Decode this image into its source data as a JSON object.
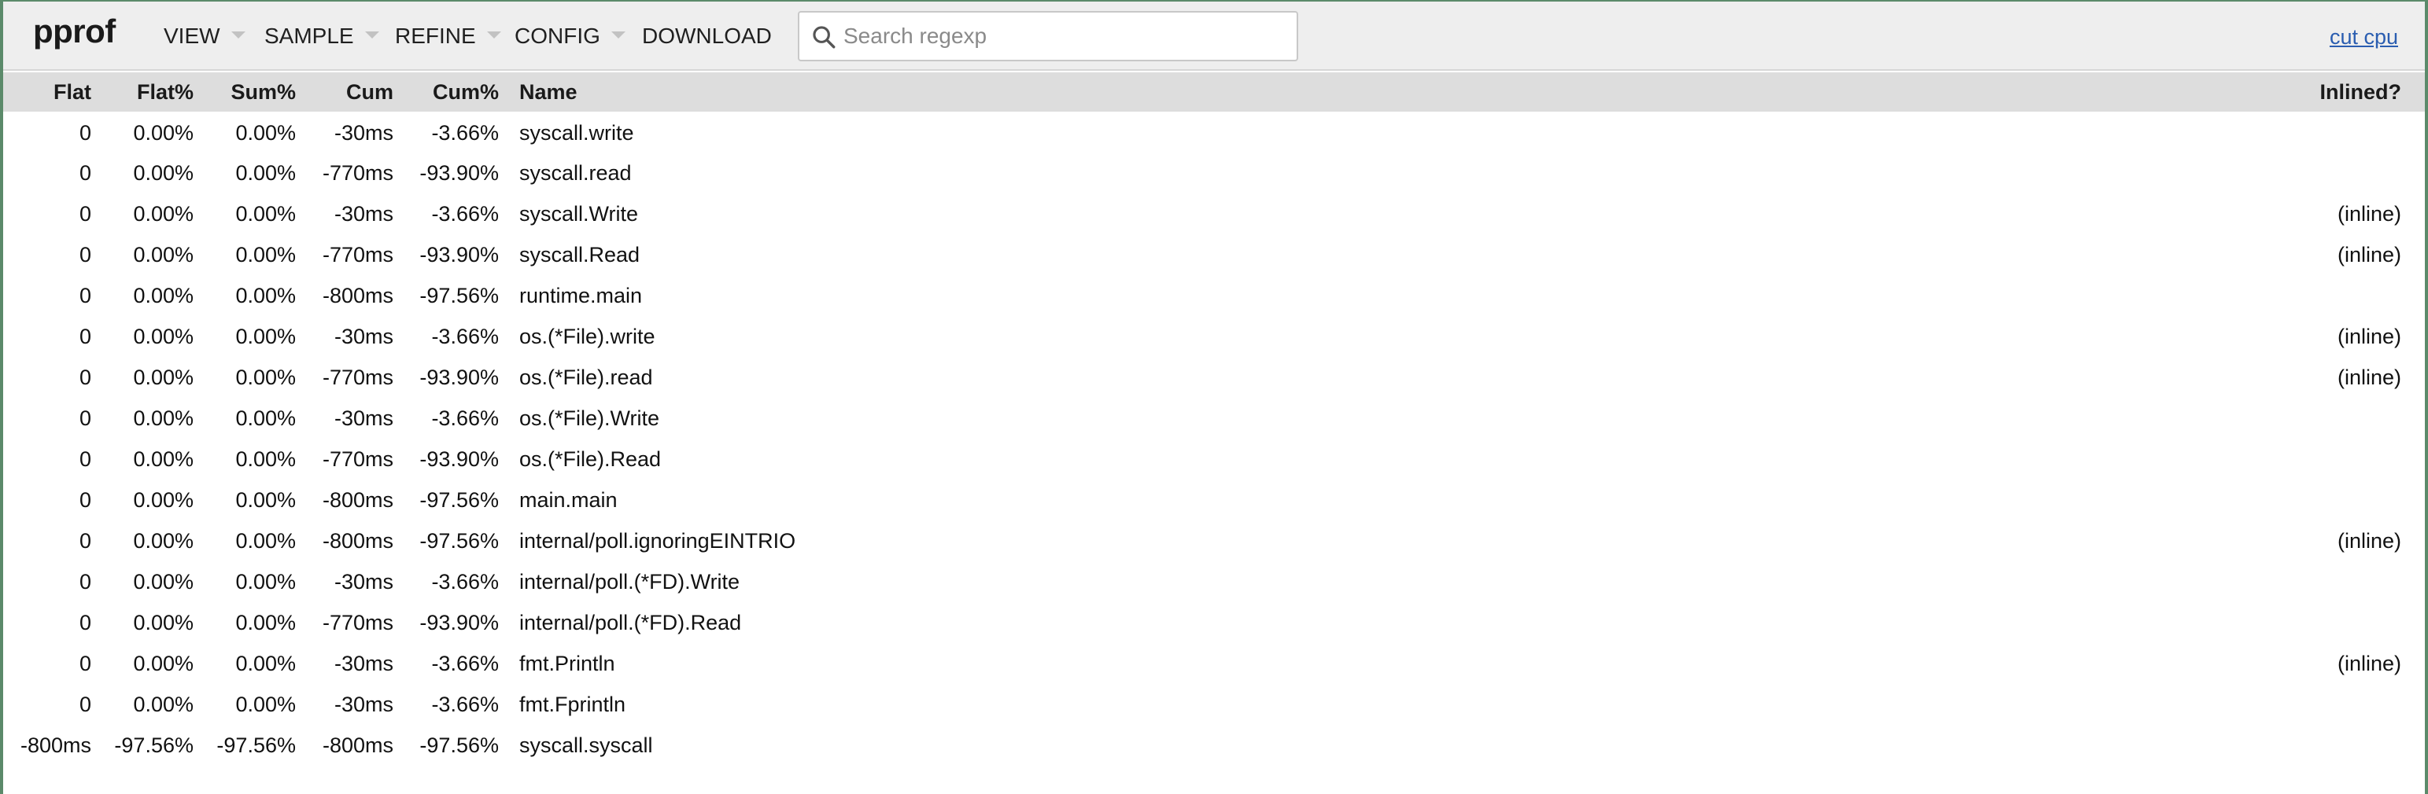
{
  "header": {
    "logo": "pprof",
    "menus": {
      "view": "VIEW",
      "sample": "SAMPLE",
      "refine": "REFINE",
      "config": "CONFIG",
      "download": "DOWNLOAD"
    },
    "search": {
      "placeholder": "Search regexp",
      "value": ""
    },
    "profile_link": "cut cpu"
  },
  "table": {
    "columns": {
      "flat": "Flat",
      "flat_pct": "Flat%",
      "sum_pct": "Sum%",
      "cum": "Cum",
      "cum_pct": "Cum%",
      "name": "Name",
      "inlined": "Inlined?"
    },
    "rows": [
      {
        "flat": "0",
        "flat_pct": "0.00%",
        "sum_pct": "0.00%",
        "cum": "-30ms",
        "cum_pct": "-3.66%",
        "name": "syscall.write",
        "inlined": ""
      },
      {
        "flat": "0",
        "flat_pct": "0.00%",
        "sum_pct": "0.00%",
        "cum": "-770ms",
        "cum_pct": "-93.90%",
        "name": "syscall.read",
        "inlined": ""
      },
      {
        "flat": "0",
        "flat_pct": "0.00%",
        "sum_pct": "0.00%",
        "cum": "-30ms",
        "cum_pct": "-3.66%",
        "name": "syscall.Write",
        "inlined": "(inline)"
      },
      {
        "flat": "0",
        "flat_pct": "0.00%",
        "sum_pct": "0.00%",
        "cum": "-770ms",
        "cum_pct": "-93.90%",
        "name": "syscall.Read",
        "inlined": "(inline)"
      },
      {
        "flat": "0",
        "flat_pct": "0.00%",
        "sum_pct": "0.00%",
        "cum": "-800ms",
        "cum_pct": "-97.56%",
        "name": "runtime.main",
        "inlined": ""
      },
      {
        "flat": "0",
        "flat_pct": "0.00%",
        "sum_pct": "0.00%",
        "cum": "-30ms",
        "cum_pct": "-3.66%",
        "name": "os.(*File).write",
        "inlined": "(inline)"
      },
      {
        "flat": "0",
        "flat_pct": "0.00%",
        "sum_pct": "0.00%",
        "cum": "-770ms",
        "cum_pct": "-93.90%",
        "name": "os.(*File).read",
        "inlined": "(inline)"
      },
      {
        "flat": "0",
        "flat_pct": "0.00%",
        "sum_pct": "0.00%",
        "cum": "-30ms",
        "cum_pct": "-3.66%",
        "name": "os.(*File).Write",
        "inlined": ""
      },
      {
        "flat": "0",
        "flat_pct": "0.00%",
        "sum_pct": "0.00%",
        "cum": "-770ms",
        "cum_pct": "-93.90%",
        "name": "os.(*File).Read",
        "inlined": ""
      },
      {
        "flat": "0",
        "flat_pct": "0.00%",
        "sum_pct": "0.00%",
        "cum": "-800ms",
        "cum_pct": "-97.56%",
        "name": "main.main",
        "inlined": ""
      },
      {
        "flat": "0",
        "flat_pct": "0.00%",
        "sum_pct": "0.00%",
        "cum": "-800ms",
        "cum_pct": "-97.56%",
        "name": "internal/poll.ignoringEINTRIO",
        "inlined": "(inline)"
      },
      {
        "flat": "0",
        "flat_pct": "0.00%",
        "sum_pct": "0.00%",
        "cum": "-30ms",
        "cum_pct": "-3.66%",
        "name": "internal/poll.(*FD).Write",
        "inlined": ""
      },
      {
        "flat": "0",
        "flat_pct": "0.00%",
        "sum_pct": "0.00%",
        "cum": "-770ms",
        "cum_pct": "-93.90%",
        "name": "internal/poll.(*FD).Read",
        "inlined": ""
      },
      {
        "flat": "0",
        "flat_pct": "0.00%",
        "sum_pct": "0.00%",
        "cum": "-30ms",
        "cum_pct": "-3.66%",
        "name": "fmt.Println",
        "inlined": "(inline)"
      },
      {
        "flat": "0",
        "flat_pct": "0.00%",
        "sum_pct": "0.00%",
        "cum": "-30ms",
        "cum_pct": "-3.66%",
        "name": "fmt.Fprintln",
        "inlined": ""
      },
      {
        "flat": "-800ms",
        "flat_pct": "-97.56%",
        "sum_pct": "-97.56%",
        "cum": "-800ms",
        "cum_pct": "-97.56%",
        "name": "syscall.syscall",
        "inlined": ""
      }
    ]
  },
  "colors": {
    "header_bg": "#eeeeee",
    "table_header_bg": "#dddddd",
    "link": "#2a5db0",
    "frame_border": "#5b8a6a"
  },
  "icons": {
    "search": "search-icon",
    "dropdown": "chevron-down-icon"
  }
}
